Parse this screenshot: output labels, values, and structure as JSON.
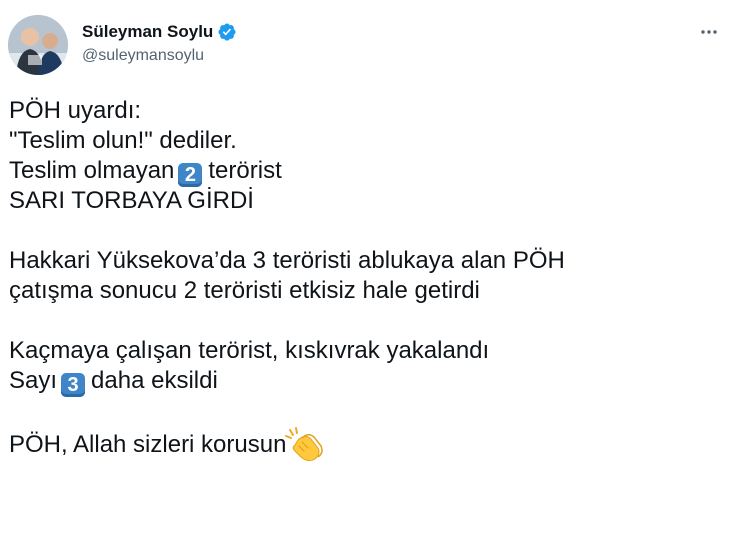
{
  "author": {
    "display_name": "Süleyman Soylu",
    "handle": "@suleymansoylu",
    "verified_icon": "verified-badge-icon",
    "avatar": "profile-photo"
  },
  "menu": {
    "more_icon": "more-horizontal-icon"
  },
  "tweet": {
    "lines": {
      "l1": "PÖH uyardı:",
      "l2": "\"Teslim olun!\" dediler.",
      "l3_before": "Teslim olmayan",
      "l3_key": "2",
      "l3_after": "terörist",
      "l4": "SARI TORBAYA GİRDİ",
      "l5": "Hakkari Yüksekova’da 3 teröristi ablukaya alan PÖH",
      "l6": "çatışma sonucu 2 teröristi etkisiz hale getirdi",
      "l7": "Kaçmaya çalışan terörist, kıskıvrak yakalandı",
      "l8_before": "Sayı",
      "l8_key": "3",
      "l8_after": "daha eksildi",
      "l9": "PÖH, Allah sizleri korusun"
    },
    "emoji": "clapping-hands-icon"
  },
  "colors": {
    "text": "#0f1419",
    "secondary": "#536471",
    "verified": "#1d9bf0",
    "keycap": "#3e86c8"
  }
}
